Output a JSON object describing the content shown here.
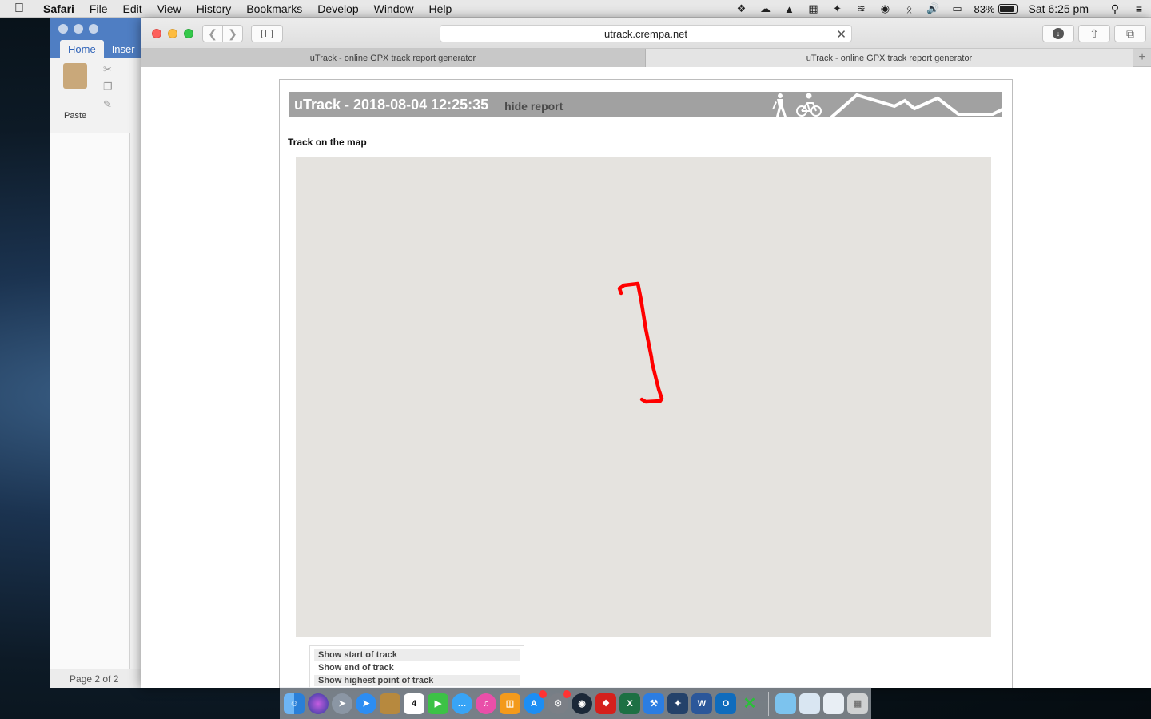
{
  "menubar": {
    "app_name": "Safari",
    "items": [
      "File",
      "Edit",
      "View",
      "History",
      "Bookmarks",
      "Develop",
      "Window",
      "Help"
    ],
    "battery": "83%",
    "clock": "Sat 6:25 pm"
  },
  "word": {
    "tabs": [
      "Home",
      "Inser"
    ],
    "paste_label": "Paste",
    "status": "Page 2 of 2"
  },
  "browser": {
    "url": "utrack.crempa.net",
    "tabs": [
      "uTrack - online GPX track report generator",
      "uTrack - online GPX track report generator"
    ]
  },
  "report": {
    "title": "uTrack - 2018-08-04 12:25:35",
    "hide_link": "hide report",
    "section_title": "Track on the map",
    "track_color": "#ff0000",
    "map_background": "#e5e3df",
    "controls": [
      "Show start of track",
      "Show end of track",
      "Show highest point of track"
    ]
  },
  "dock": {
    "icons": [
      "finder-icon",
      "siri-icon",
      "launchpad-icon",
      "safari-icon",
      "notes-icon",
      "calendar-icon",
      "facetime-icon",
      "messages-icon",
      "itunes-icon",
      "ibooks-icon",
      "appstore-icon",
      "system-preferences-icon",
      "steam-icon",
      "acrobat-icon",
      "excel-icon",
      "xcode-icon",
      "instruments-icon",
      "word-icon",
      "outlook-icon",
      "xquartz-icon",
      "downloads-folder-icon",
      "documents-folder-icon",
      "desktop-folder-icon",
      "trash-icon"
    ],
    "calendar_day": "4"
  }
}
